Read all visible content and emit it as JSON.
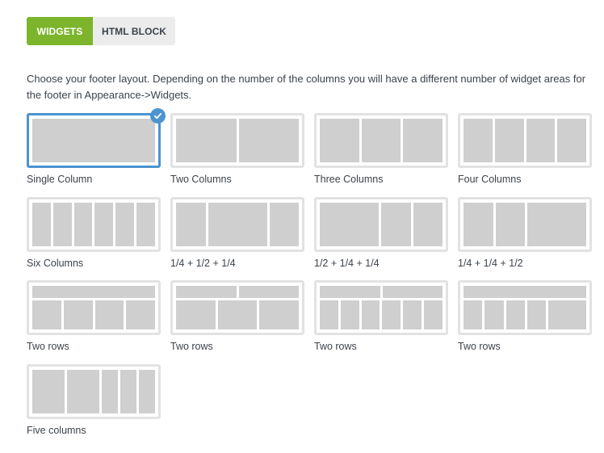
{
  "tabs": [
    {
      "label": "WIDGETS",
      "active": true
    },
    {
      "label": "HTML BLOCK",
      "active": false
    }
  ],
  "description": "Choose your footer layout. Depending on the number of the columns you will have a different number of widget areas for the footer in Appearance->Widgets.",
  "colors": {
    "accent_green": "#7cb52c",
    "selected_blue": "#4c94d0",
    "placeholder_gray": "#cfcfcf",
    "border_gray": "#e2e2e2"
  },
  "selected_icon": "check-icon",
  "layouts": [
    {
      "label": "Single Column",
      "selected": true,
      "rows": [
        [
          1
        ]
      ]
    },
    {
      "label": "Two Columns",
      "selected": false,
      "rows": [
        [
          1,
          1
        ]
      ]
    },
    {
      "label": "Three Columns",
      "selected": false,
      "rows": [
        [
          1,
          1,
          1
        ]
      ]
    },
    {
      "label": "Four Columns",
      "selected": false,
      "rows": [
        [
          1,
          1,
          1,
          1
        ]
      ]
    },
    {
      "label": "Six Columns",
      "selected": false,
      "rows": [
        [
          1,
          1,
          1,
          1,
          1,
          1
        ]
      ]
    },
    {
      "label": "1/4 + 1/2 + 1/4",
      "selected": false,
      "rows": [
        [
          1,
          2,
          1
        ]
      ]
    },
    {
      "label": "1/2 + 1/4 + 1/4",
      "selected": false,
      "rows": [
        [
          2,
          1,
          1
        ]
      ]
    },
    {
      "label": "1/4 + 1/4 + 1/2",
      "selected": false,
      "rows": [
        [
          1,
          1,
          2
        ]
      ]
    },
    {
      "label": "Two rows",
      "selected": false,
      "rows": [
        [
          1
        ],
        [
          1,
          1,
          1,
          1
        ]
      ]
    },
    {
      "label": "Two rows",
      "selected": false,
      "rows": [
        [
          1,
          1
        ],
        [
          1,
          1,
          1
        ]
      ]
    },
    {
      "label": "Two rows",
      "selected": false,
      "rows": [
        [
          1,
          1
        ],
        [
          1,
          1,
          1,
          1,
          1,
          1
        ]
      ]
    },
    {
      "label": "Two rows",
      "selected": false,
      "rows": [
        [
          1
        ],
        [
          1,
          1,
          1,
          1,
          2
        ]
      ]
    },
    {
      "label": "Five columns",
      "selected": false,
      "rows": [
        [
          2,
          2,
          1,
          1,
          1
        ]
      ]
    }
  ]
}
